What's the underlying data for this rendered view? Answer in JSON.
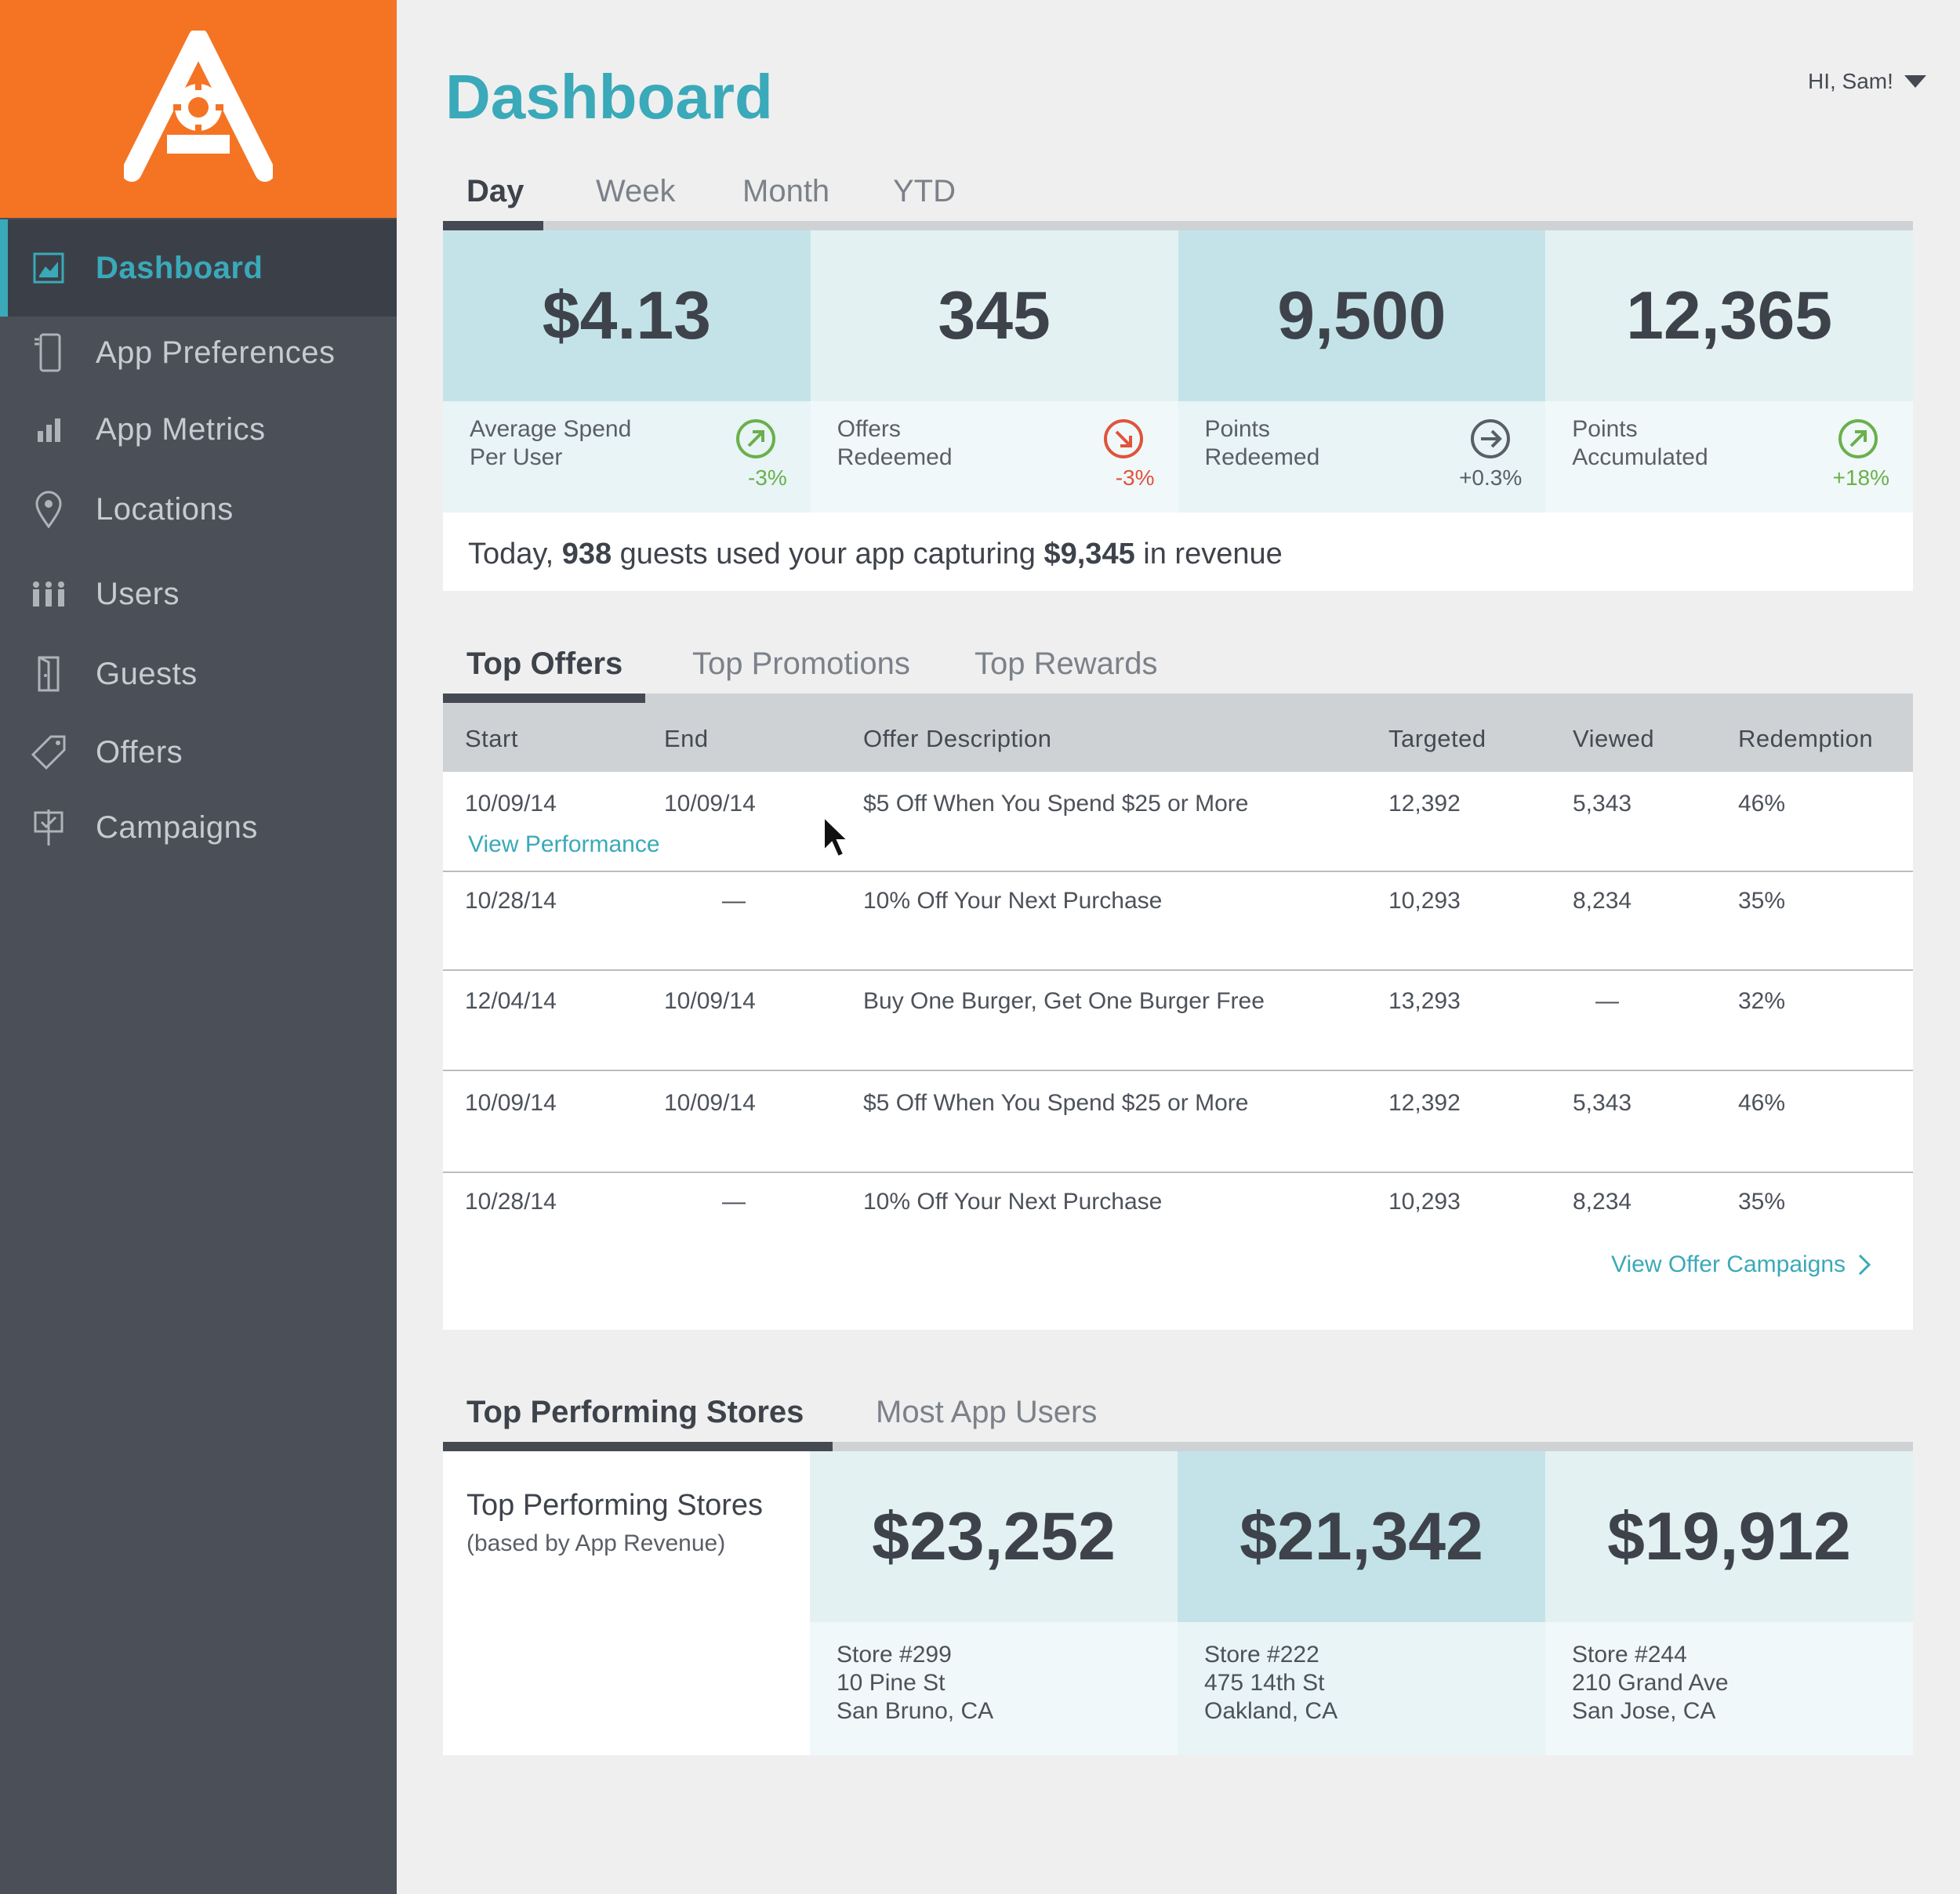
{
  "sidebar": {
    "items": [
      {
        "label": "Dashboard",
        "icon": "dashboard-icon"
      },
      {
        "label": "App Preferences",
        "icon": "phone-icon"
      },
      {
        "label": "App Metrics",
        "icon": "bar-chart-icon"
      },
      {
        "label": "Locations",
        "icon": "map-pin-icon"
      },
      {
        "label": "Users",
        "icon": "users-icon"
      },
      {
        "label": "Guests",
        "icon": "door-icon"
      },
      {
        "label": "Offers",
        "icon": "tag-icon"
      },
      {
        "label": "Campaigns",
        "icon": "sign-icon"
      }
    ]
  },
  "header": {
    "title": "Dashboard",
    "user_greeting": "HI, Sam!"
  },
  "period_tabs": [
    "Day",
    "Week",
    "Month",
    "YTD"
  ],
  "kpis": [
    {
      "value": "$4.13",
      "label": "Average Spend\nPer User",
      "change": "-3%",
      "trend": "up",
      "color": "#6ab04c"
    },
    {
      "value": "345",
      "label": "Offers\nRedeemed",
      "change": "-3%",
      "trend": "down",
      "color": "#e0533d"
    },
    {
      "value": "9,500",
      "label": "Points\nRedeemed",
      "change": "+0.3%",
      "trend": "flat",
      "color": "#5a5f66"
    },
    {
      "value": "12,365",
      "label": "Points\nAccumulated",
      "change": "+18%",
      "trend": "up",
      "color": "#6ab04c"
    }
  ],
  "summary": {
    "prefix": "Today, ",
    "guests": "938",
    "middle": " guests used your app capturing ",
    "revenue": "$9,345",
    "suffix": " in revenue"
  },
  "offer_tabs": [
    "Top Offers",
    "Top Promotions",
    "Top Rewards"
  ],
  "offers_table": {
    "columns": [
      "Start",
      "End",
      "Offer Description",
      "Targeted",
      "Viewed",
      "Redemption"
    ],
    "rows": [
      {
        "start": "10/09/14",
        "end": "10/09/14",
        "desc": "$5 Off When You Spend $25 or More",
        "targeted": "12,392",
        "viewed": "5,343",
        "redemption": "46%"
      },
      {
        "start": "10/28/14",
        "end": "—",
        "desc": "10% Off Your Next Purchase",
        "targeted": "10,293",
        "viewed": "8,234",
        "redemption": "35%"
      },
      {
        "start": "12/04/14",
        "end": "10/09/14",
        "desc": "Buy One Burger, Get One Burger Free",
        "targeted": "13,293",
        "viewed": "—",
        "redemption": "32%"
      },
      {
        "start": "10/09/14",
        "end": "10/09/14",
        "desc": "$5 Off When You Spend $25 or More",
        "targeted": "12,392",
        "viewed": "5,343",
        "redemption": "46%"
      },
      {
        "start": "10/28/14",
        "end": "—",
        "desc": "10% Off Your Next Purchase",
        "targeted": "10,293",
        "viewed": "8,234",
        "redemption": "35%"
      }
    ],
    "view_performance": "View Performance",
    "view_campaigns": "View Offer Campaigns"
  },
  "store_tabs": [
    "Top Performing Stores",
    "Most App Users"
  ],
  "stores": {
    "title": "Top Performing Stores",
    "subtitle": "(based by App Revenue)",
    "items": [
      {
        "value": "$23,252",
        "address": "Store #299\n10 Pine St\nSan Bruno, CA"
      },
      {
        "value": "$21,342",
        "address": "Store #222\n475 14th St\nOakland, CA"
      },
      {
        "value": "$19,912",
        "address": "Store #244\n210 Grand Ave\nSan Jose, CA"
      }
    ]
  },
  "colors": {
    "brand": "#f47424",
    "accent": "#3aa9b9",
    "sidebar": "#4a4f58"
  }
}
